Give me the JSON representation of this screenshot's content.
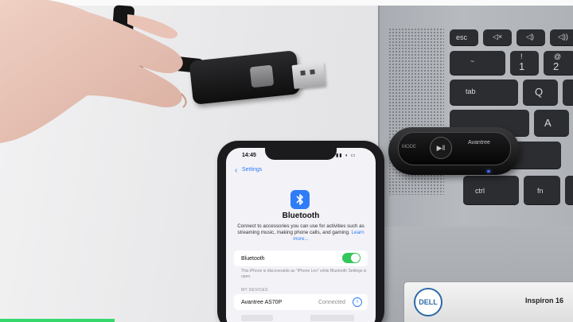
{
  "phone": {
    "status_time": "14:45",
    "back_label": "Settings",
    "page_title": "Bluetooth",
    "description": "Connect to accessories you can use for activities such as streaming music, making phone calls, and gaming.",
    "learn_more": "Learn more...",
    "bluetooth_row_label": "Bluetooth",
    "bluetooth_on": true,
    "discoverable_note": "This iPhone is discoverable as \"iPhone Leo\" while Bluetooth Settings is open.",
    "my_devices_header": "MY DEVICES",
    "device_name": "Avantree AS70P",
    "device_status": "Connected"
  },
  "receiver": {
    "mode_label": "MODE",
    "play_glyph": "▶‖",
    "brand_label": "Avantree"
  },
  "laptop": {
    "keys": {
      "esc": "esc",
      "tab": "tab",
      "ctrl": "ctrl",
      "fn": "fn",
      "q": "Q",
      "a": "A",
      "one_top": "!",
      "one": "1",
      "two_top": "@",
      "two": "2"
    },
    "brand": "DELL",
    "model": "Inspiron 16"
  },
  "video": {
    "progress": 0.2
  },
  "colors": {
    "ios_blue": "#2f7cf6",
    "toggle_green": "#34c759",
    "progress_green": "#34d86b"
  }
}
